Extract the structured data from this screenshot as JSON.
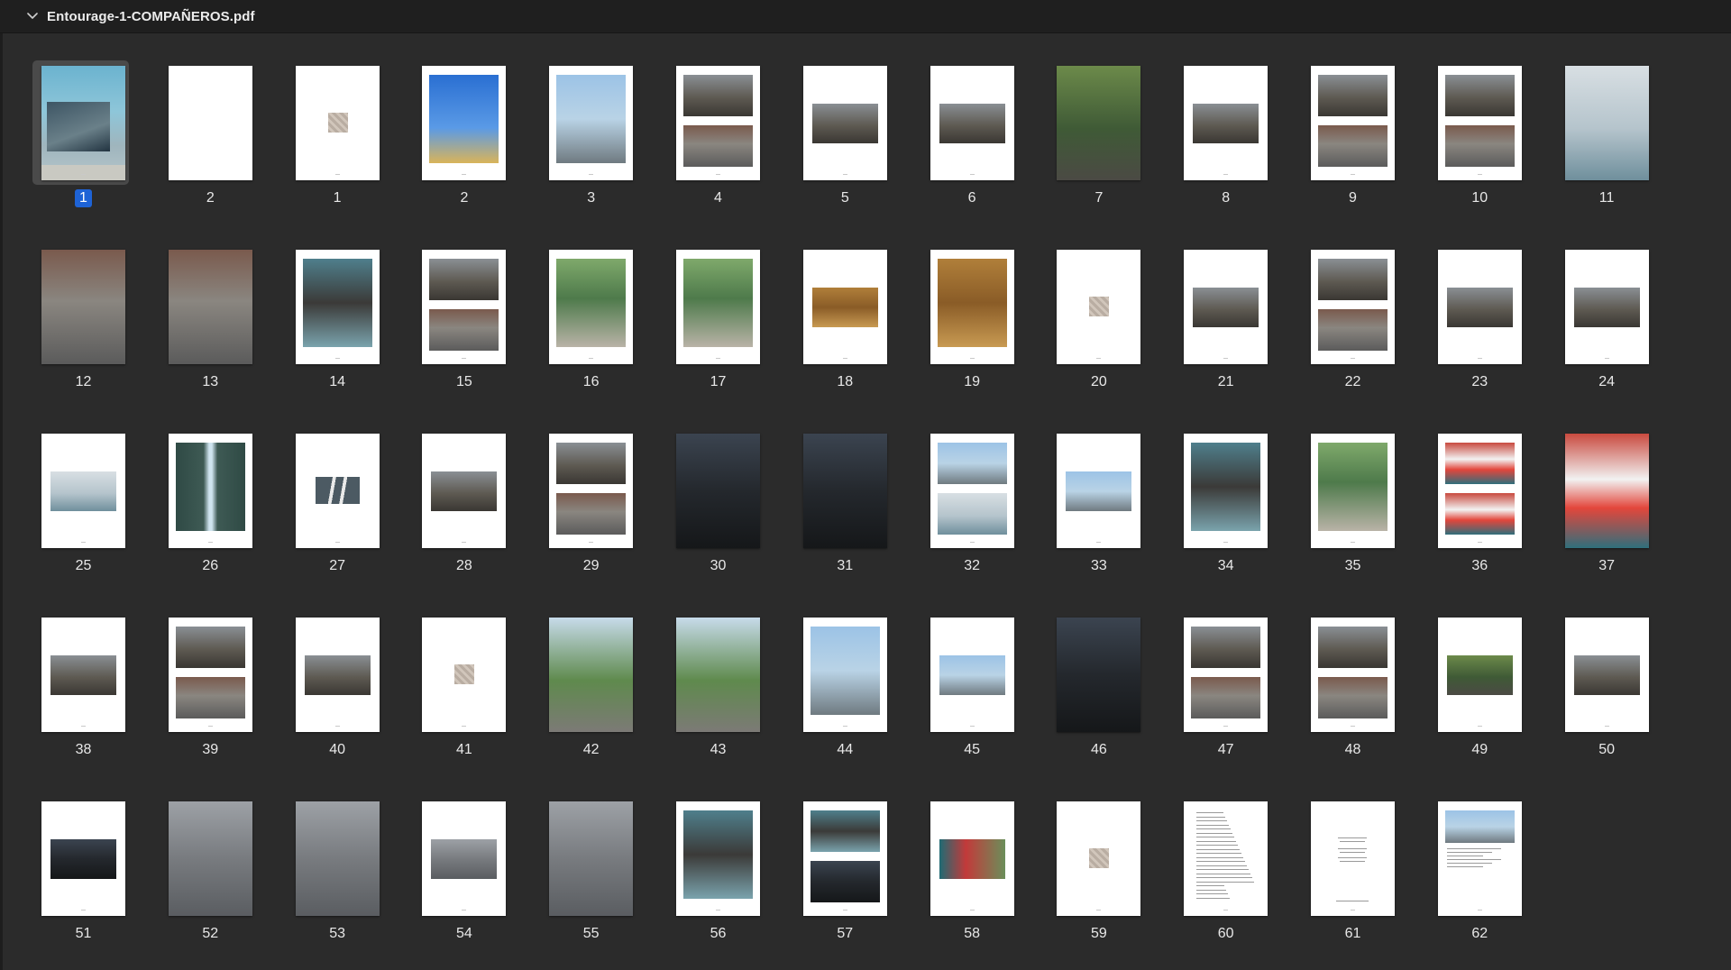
{
  "window": {
    "title": "Entourage-1-COMPAÑEROS.pdf"
  },
  "selected_index": 0,
  "pages": [
    {
      "label": "1",
      "kind": "cover"
    },
    {
      "label": "2",
      "kind": "blank"
    },
    {
      "label": "1",
      "kind": "logo"
    },
    {
      "label": "2",
      "kind": "tall-blue"
    },
    {
      "label": "3",
      "kind": "tall-sky"
    },
    {
      "label": "4",
      "kind": "two"
    },
    {
      "label": "5",
      "kind": "mid"
    },
    {
      "label": "6",
      "kind": "mid"
    },
    {
      "label": "7",
      "kind": "full-green"
    },
    {
      "label": "8",
      "kind": "mid"
    },
    {
      "label": "9",
      "kind": "two"
    },
    {
      "label": "10",
      "kind": "two"
    },
    {
      "label": "11",
      "kind": "full-stairs"
    },
    {
      "label": "12",
      "kind": "full-street"
    },
    {
      "label": "13",
      "kind": "full-street"
    },
    {
      "label": "14",
      "kind": "tall-portrait"
    },
    {
      "label": "15",
      "kind": "two"
    },
    {
      "label": "16",
      "kind": "tall-trees"
    },
    {
      "label": "17",
      "kind": "tall-trees"
    },
    {
      "label": "18",
      "kind": "mid-wood"
    },
    {
      "label": "19",
      "kind": "tall-wood"
    },
    {
      "label": "20",
      "kind": "logo"
    },
    {
      "label": "21",
      "kind": "mid"
    },
    {
      "label": "22",
      "kind": "two"
    },
    {
      "label": "23",
      "kind": "mid"
    },
    {
      "label": "24",
      "kind": "mid"
    },
    {
      "label": "25",
      "kind": "mid-light"
    },
    {
      "label": "26",
      "kind": "tall-gap"
    },
    {
      "label": "27",
      "kind": "mid-gray"
    },
    {
      "label": "28",
      "kind": "mid"
    },
    {
      "label": "29",
      "kind": "two"
    },
    {
      "label": "30",
      "kind": "full-dark"
    },
    {
      "label": "31",
      "kind": "full-dark"
    },
    {
      "label": "32",
      "kind": "two-sky"
    },
    {
      "label": "33",
      "kind": "mid-sky"
    },
    {
      "label": "34",
      "kind": "tall-portrait"
    },
    {
      "label": "35",
      "kind": "tall-trees"
    },
    {
      "label": "36",
      "kind": "two-red"
    },
    {
      "label": "37",
      "kind": "full-red"
    },
    {
      "label": "38",
      "kind": "mid"
    },
    {
      "label": "39",
      "kind": "two"
    },
    {
      "label": "40",
      "kind": "mid"
    },
    {
      "label": "41",
      "kind": "logo"
    },
    {
      "label": "42",
      "kind": "full-palm"
    },
    {
      "label": "43",
      "kind": "full-palm"
    },
    {
      "label": "44",
      "kind": "tall-sky"
    },
    {
      "label": "45",
      "kind": "mid-sky"
    },
    {
      "label": "46",
      "kind": "full-dark"
    },
    {
      "label": "47",
      "kind": "two"
    },
    {
      "label": "48",
      "kind": "two"
    },
    {
      "label": "49",
      "kind": "mid-green"
    },
    {
      "label": "50",
      "kind": "mid"
    },
    {
      "label": "51",
      "kind": "mid-dark"
    },
    {
      "label": "52",
      "kind": "full-concrete"
    },
    {
      "label": "53",
      "kind": "full-concrete"
    },
    {
      "label": "54",
      "kind": "mid-concrete"
    },
    {
      "label": "55",
      "kind": "full-concrete"
    },
    {
      "label": "56",
      "kind": "tall-portrait"
    },
    {
      "label": "57",
      "kind": "two-blue"
    },
    {
      "label": "58",
      "kind": "mid-red"
    },
    {
      "label": "59",
      "kind": "logo"
    },
    {
      "label": "60",
      "kind": "text"
    },
    {
      "label": "61",
      "kind": "text-center"
    },
    {
      "label": "62",
      "kind": "text-photo"
    }
  ]
}
